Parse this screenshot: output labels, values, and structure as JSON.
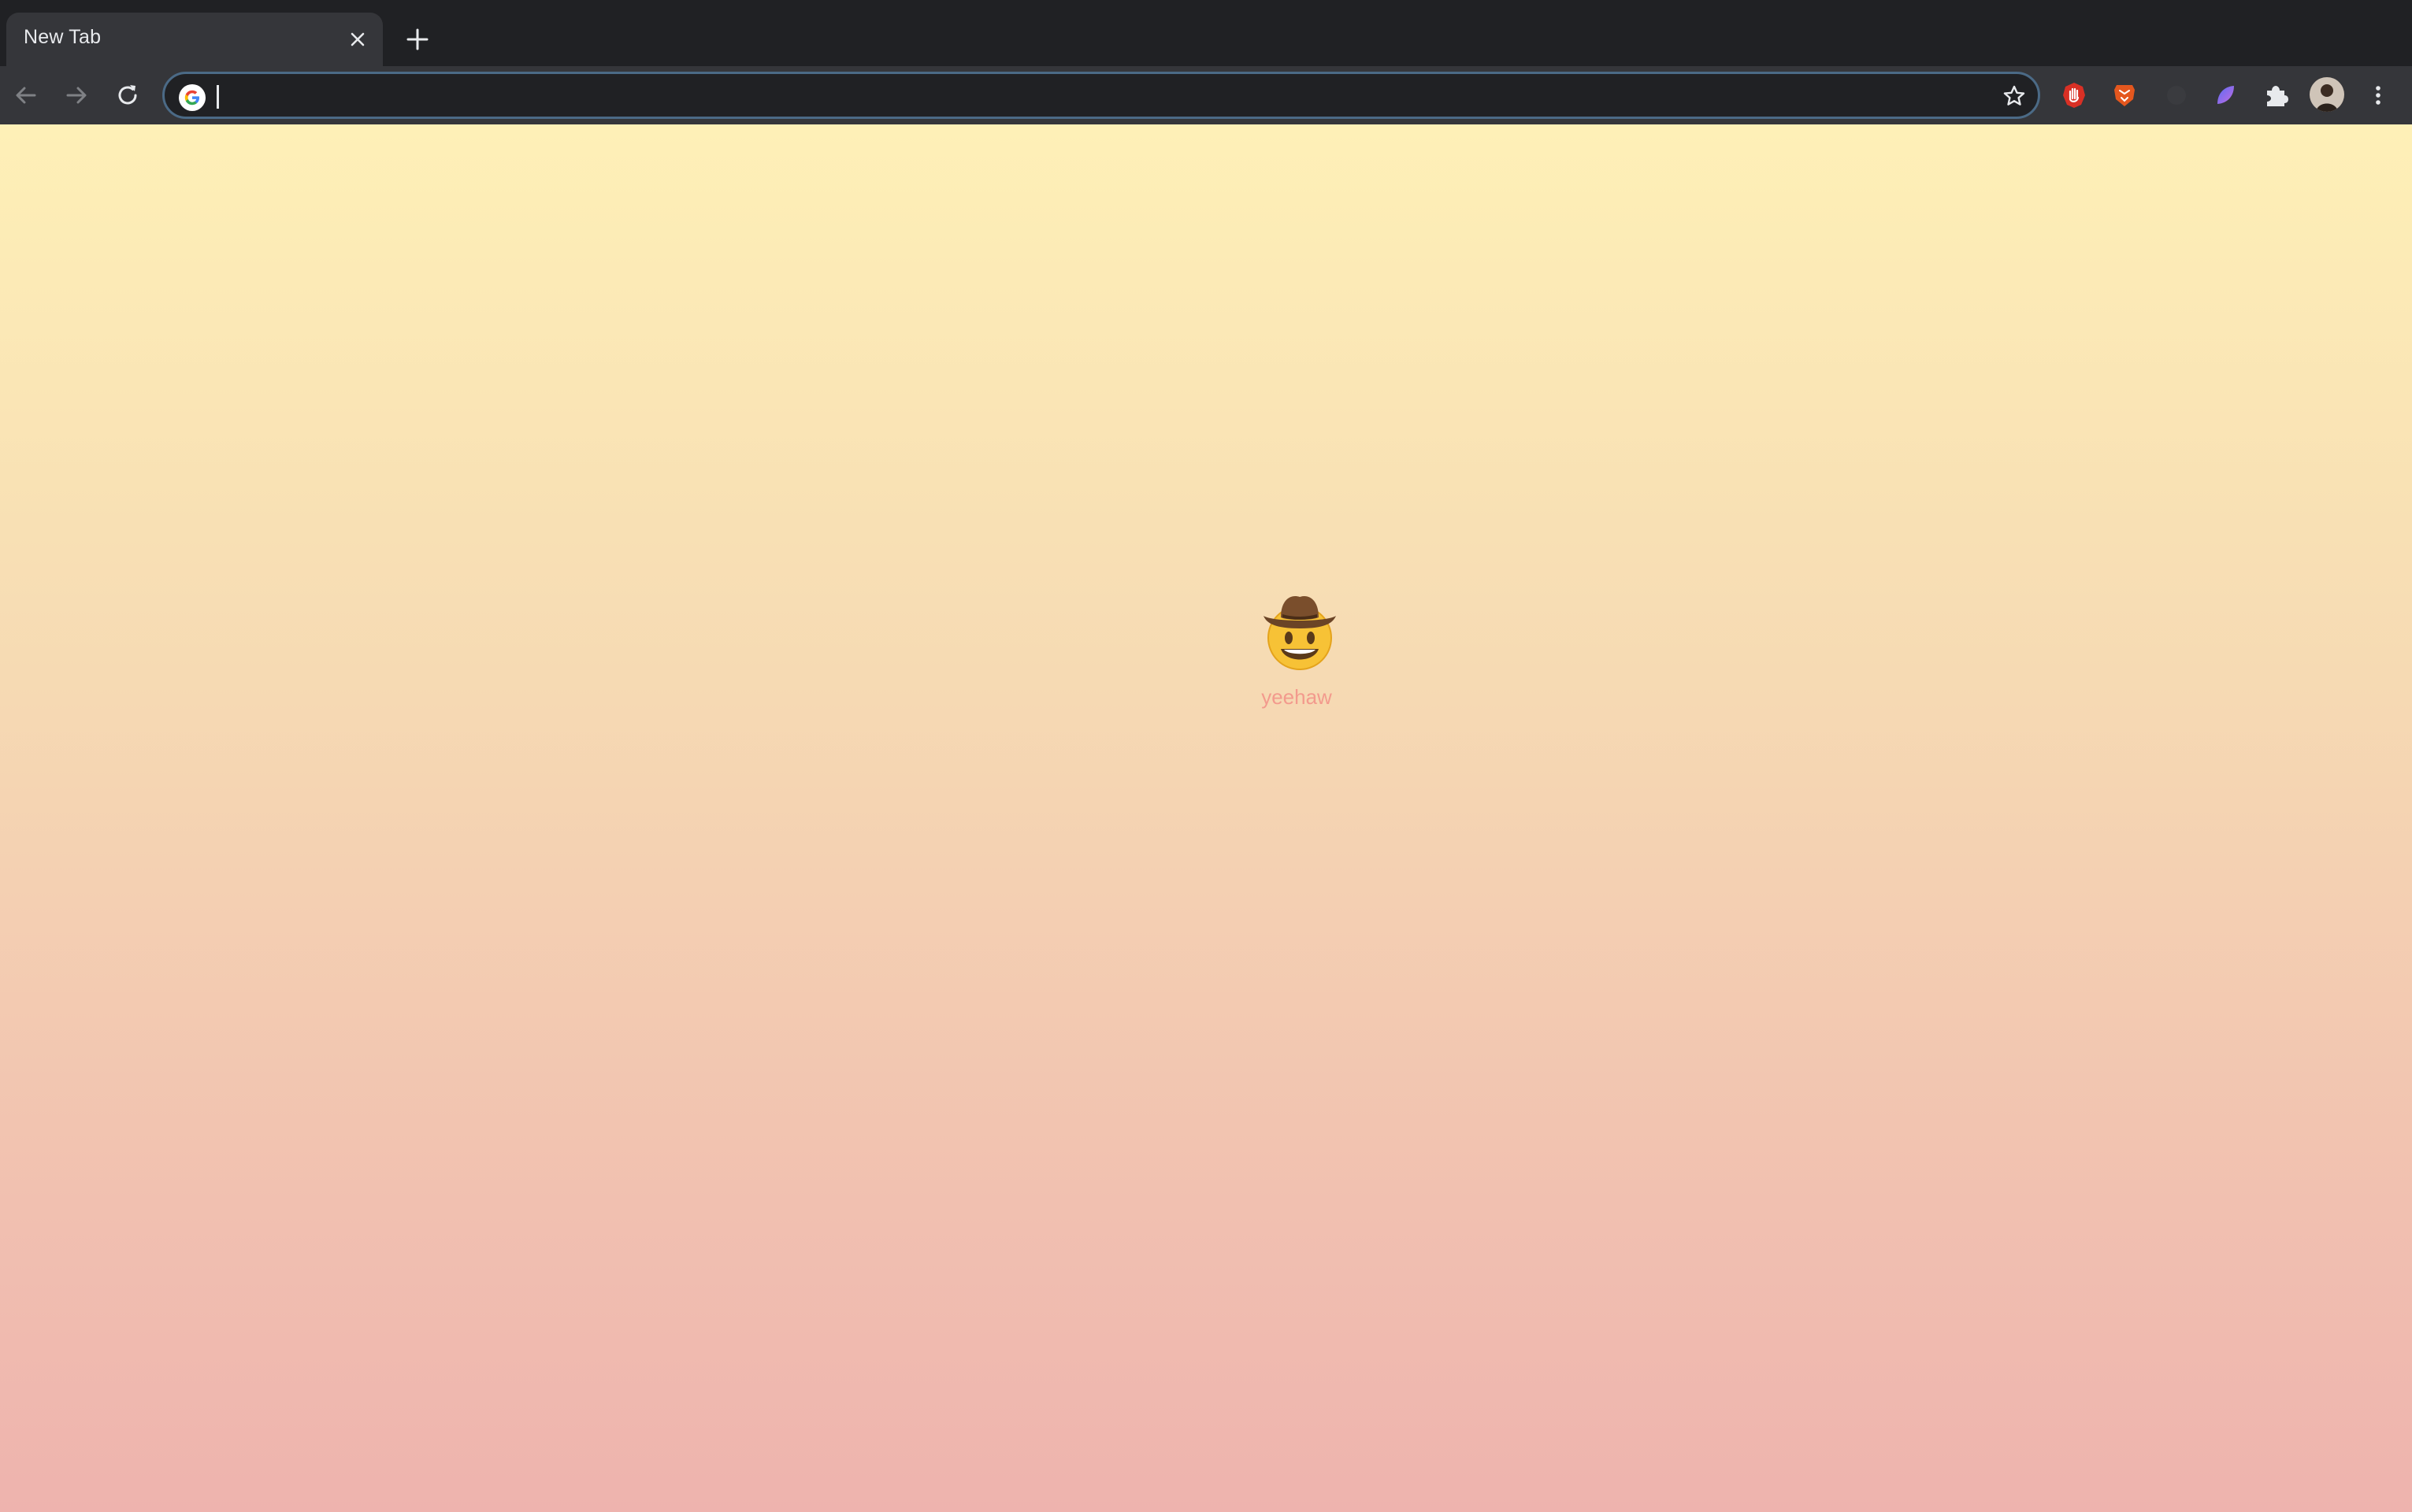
{
  "tabs": [
    {
      "title": "New Tab",
      "active": true
    }
  ],
  "toolbar": {
    "omnibox_value": "",
    "icons": {
      "back": "arrow-back-icon",
      "forward": "arrow-forward-icon",
      "reload": "reload-icon",
      "site": "google-g-icon",
      "bookmark": "star-outline-icon",
      "new_tab": "plus-icon",
      "close_tab": "close-icon",
      "extensions": "puzzle-icon",
      "menu": "kebab-menu-icon"
    },
    "extension_icons": [
      "stop-hand-icon",
      "brave-lion-icon",
      "dark-extension-icon",
      "feather-icon"
    ]
  },
  "page": {
    "emoji": "🤠",
    "caption": "yeehaw",
    "colors": {
      "gradient_top": "#fef0b7",
      "gradient_bottom": "#eeb3ae",
      "caption": "#f39a8d"
    }
  }
}
